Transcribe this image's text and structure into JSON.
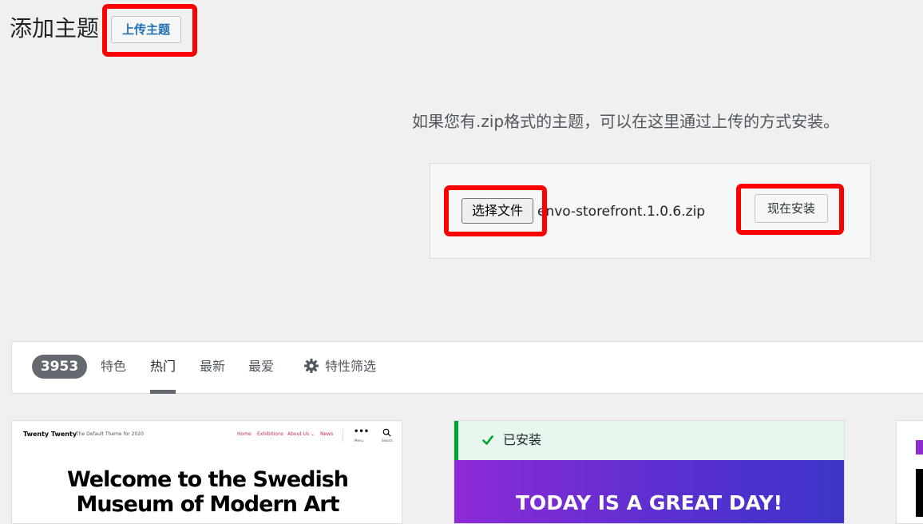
{
  "header": {
    "title": "添加主题",
    "upload_button": "上传主题"
  },
  "upload": {
    "description": "如果您有.zip格式的主题，可以在这里通过上传的方式安装。",
    "choose_file_button": "选择文件",
    "chosen_file": "envo-storefront.1.0.6.zip",
    "install_button": "现在安装"
  },
  "filter_bar": {
    "count": "3953",
    "tabs": [
      {
        "label": "特色"
      },
      {
        "label": "热门"
      },
      {
        "label": "最新"
      },
      {
        "label": "最爱"
      }
    ],
    "feature_filter": "特性筛选",
    "current_tab": "热门"
  },
  "themes": [
    {
      "preview": {
        "site_title": "Twenty Twenty",
        "tagline": "The Default Theme for 2020",
        "nav": [
          "Home",
          "Exhibitions",
          "About Us ⌄",
          "News"
        ],
        "menu_label": "Menu",
        "search_label": "Search",
        "heading_line1": "Welcome to the Swedish",
        "heading_line2": "Museum of Modern Art"
      }
    },
    {
      "installed_label": "已安装",
      "preview": {
        "heading": "TODAY IS A GREAT DAY!"
      }
    },
    {
      "preview": {}
    }
  ],
  "colors": {
    "annotation": "#ff0000",
    "link_blue": "#2271b1",
    "installed_green": "#00a32a",
    "nav_red": "#cd2653"
  }
}
